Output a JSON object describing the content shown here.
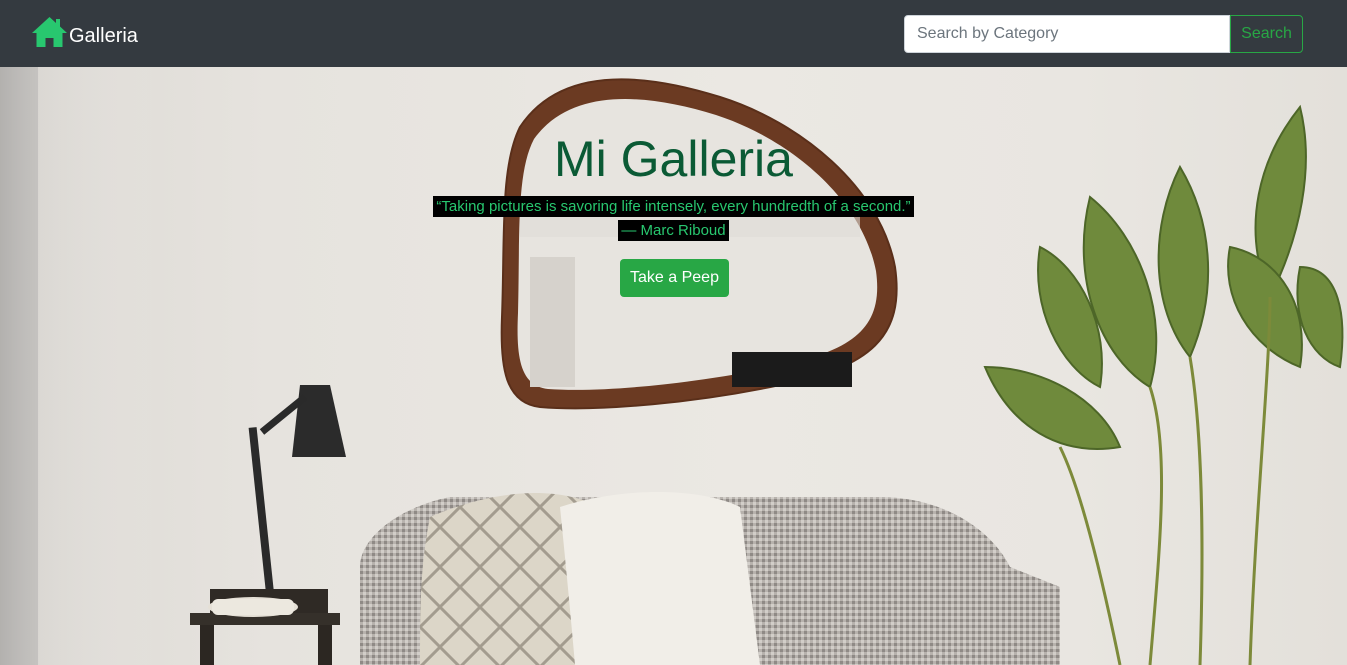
{
  "navbar": {
    "brand": "Galleria",
    "search_placeholder": "Search by Category",
    "search_button": "Search"
  },
  "hero": {
    "title": "Mi Galleria",
    "quote": "“Taking pictures is savoring life intensely, every hundredth of a second.”",
    "author": "— Marc Riboud",
    "cta_label": "Take a Peep"
  },
  "colors": {
    "navbar_bg": "#343a40",
    "brand_icon": "#28c76f",
    "accent_green": "#28a745",
    "title_green": "#0b5a35",
    "quote_green": "#28c76f"
  },
  "icons": {
    "brand_icon": "house-icon"
  }
}
